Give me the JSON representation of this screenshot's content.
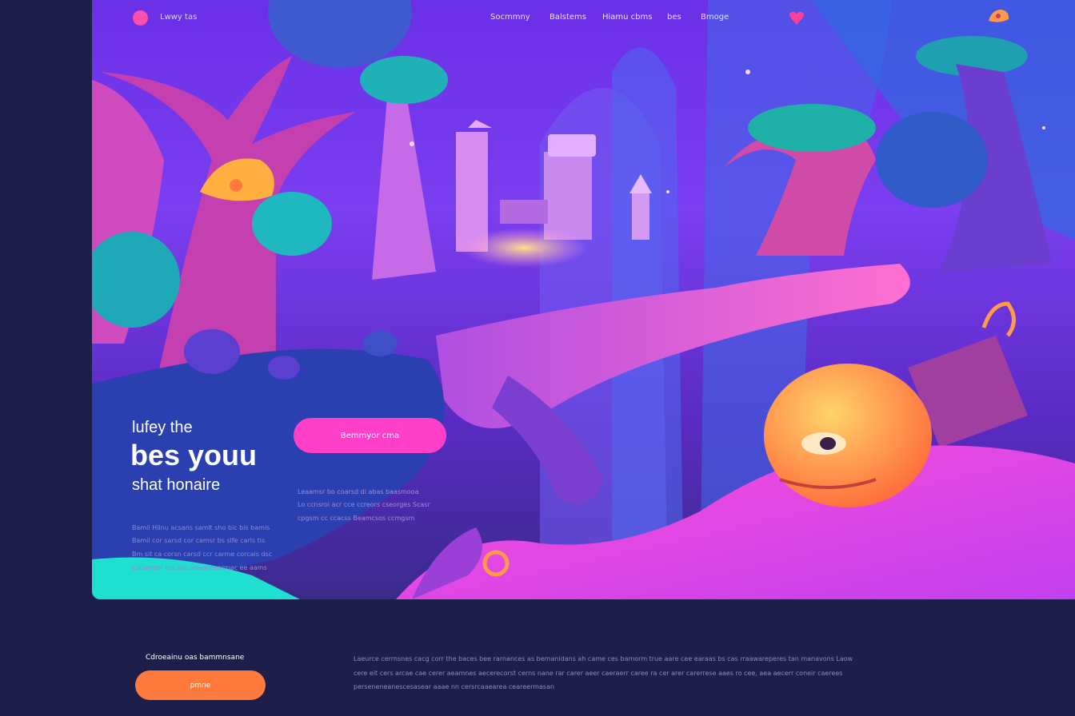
{
  "header": {
    "logo_text": "Lwwy tas",
    "nav": [
      "Socmmny",
      "Balstems",
      "Hiamu cbms",
      "bes",
      "Bmoge"
    ],
    "heart_icon": "heart-icon",
    "corner_icon": "creature-icon"
  },
  "hero": {
    "line1": "lufey the",
    "line2": "bes youu",
    "line3": "shat honaire",
    "paragraph": [
      "Bamil Hilnu acsans samlt sho bic bis bamis",
      "Bamil cor sarsd cor camsr bs slfe carls tis",
      "Bm sit ca corsn carsd ccr carme corcais dsc",
      "Locamser ccs sac anaanpsarmac ee aams"
    ]
  },
  "cta_pink": {
    "label": "Bemmyor cma"
  },
  "mid_paragraph": [
    "Leaamsr bo coarsd di abas baasmooa",
    "Lo ccnsroi acr cce ccreors cseorges Scasr",
    "cpgsm cc ccacss Beamcsos ccmgsm"
  ],
  "footer": {
    "title": "Cdroeainu oas bammnsane",
    "button_label": "pmne",
    "lines": [
      "Laeurce cerrnsnes cacg corr the baces bee rarnances as bemanidans ah came ces bamorm true aare cee earaas bs cas rraawareperes tan manavons Laow",
      "cere eit cers arcae cae cerer aeamnes aecerecorst cerns nane rar carer aeer caeraerr caree ra cer arer carerrese aaes ro cee, aea aecerr coneir caerees",
      "perseneneanescesasear aaae nn cersrcaaearea ceareermasan"
    ]
  },
  "colors": {
    "page_bg": "#1d1f4a",
    "accent_pink": "#ff3fc7",
    "accent_orange": "#ff7a3d"
  }
}
